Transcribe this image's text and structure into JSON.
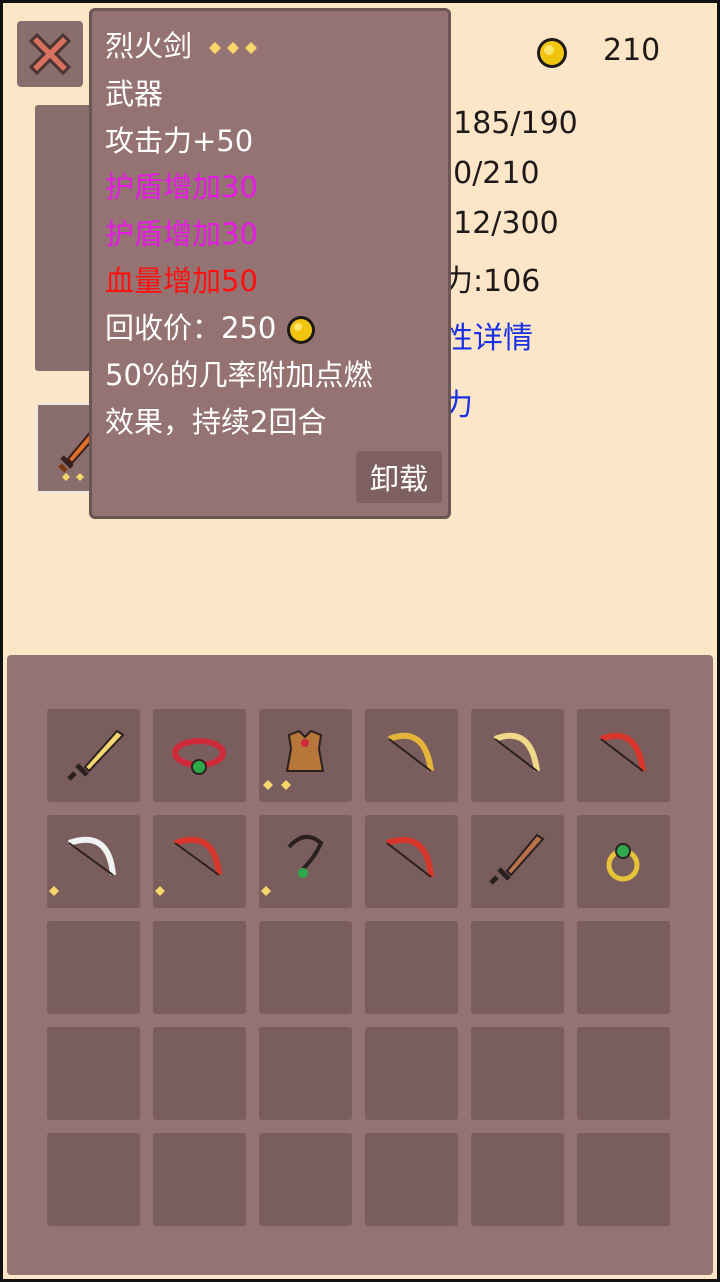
{
  "header": {
    "gold": "210",
    "coin_icon": "gold-coin-icon"
  },
  "stats": {
    "hp": ":185/190",
    "shield": ":0/210",
    "exp": ":12/300",
    "attack": "力:106",
    "details_link": "性详情",
    "power_link": "力"
  },
  "tooltip": {
    "name": "烈火剑",
    "type": "武器",
    "attack": "攻击力+50",
    "bonus1": "护盾增加30",
    "bonus2": "护盾增加30",
    "bonus3": "血量增加50",
    "price": "回收价：250",
    "desc1": "50%的几率附加点燃",
    "desc2": "效果，持续2回合",
    "unequip_label": "卸载",
    "stars": 3
  },
  "equipment": [
    {
      "slot": "weapon",
      "icon": "flame-sword-icon",
      "stars": 3,
      "selected": true
    },
    {
      "slot": "necklace",
      "icon": "amulet-icon"
    },
    {
      "slot": "ring",
      "icon": "ring-icon"
    }
  ],
  "inventory": {
    "items": [
      {
        "icon": "gold-sword-icon",
        "stars": 0
      },
      {
        "icon": "red-gem-necklace-icon",
        "stars": 0
      },
      {
        "icon": "leather-armor-icon",
        "stars": 2
      },
      {
        "icon": "gold-bow-icon",
        "stars": 0
      },
      {
        "icon": "gold-bow-icon",
        "stars": 0
      },
      {
        "icon": "red-bow-icon",
        "stars": 0
      },
      {
        "icon": "white-bow-icon",
        "stars": 1
      },
      {
        "icon": "red-bow-icon",
        "stars": 1
      },
      {
        "icon": "pendant-icon",
        "stars": 1
      },
      {
        "icon": "red-bow-icon",
        "stars": 0
      },
      {
        "icon": "wooden-sword-icon",
        "stars": 0
      },
      {
        "icon": "emerald-ring-icon",
        "stars": 0
      }
    ],
    "empty_slots": 18
  },
  "colors": {
    "magenta": "#e619e6",
    "red": "#ff1010",
    "link_blue": "#1730e6",
    "panel": "#957373",
    "background": "#fde6c7"
  }
}
